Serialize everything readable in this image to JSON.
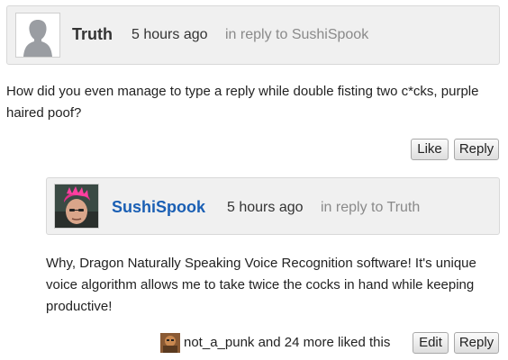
{
  "comment1": {
    "author": "Truth",
    "time": "5 hours ago",
    "reply_to": "in reply to SushiSpook",
    "body": "How did you even manage to type a reply while double fisting two c*cks, purple haired poof?",
    "like_label": "Like",
    "reply_label": "Reply",
    "avatar_icon": "default-user-silhouette-icon"
  },
  "comment2": {
    "author": "SushiSpook",
    "author_color": "#1a5fb4",
    "time": "5 hours ago",
    "reply_to": "in reply to Truth",
    "body": "Why, Dragon Naturally Speaking Voice Recognition software! It's unique voice algorithm allows me to take twice the cocks in hand while keeping productive!",
    "liked_by_user": "not_a_punk",
    "liked_by_rest": " and 24 more liked this",
    "edit_label": "Edit",
    "reply_label": "Reply",
    "avatar_icon": "pink-haired-user-avatar"
  }
}
